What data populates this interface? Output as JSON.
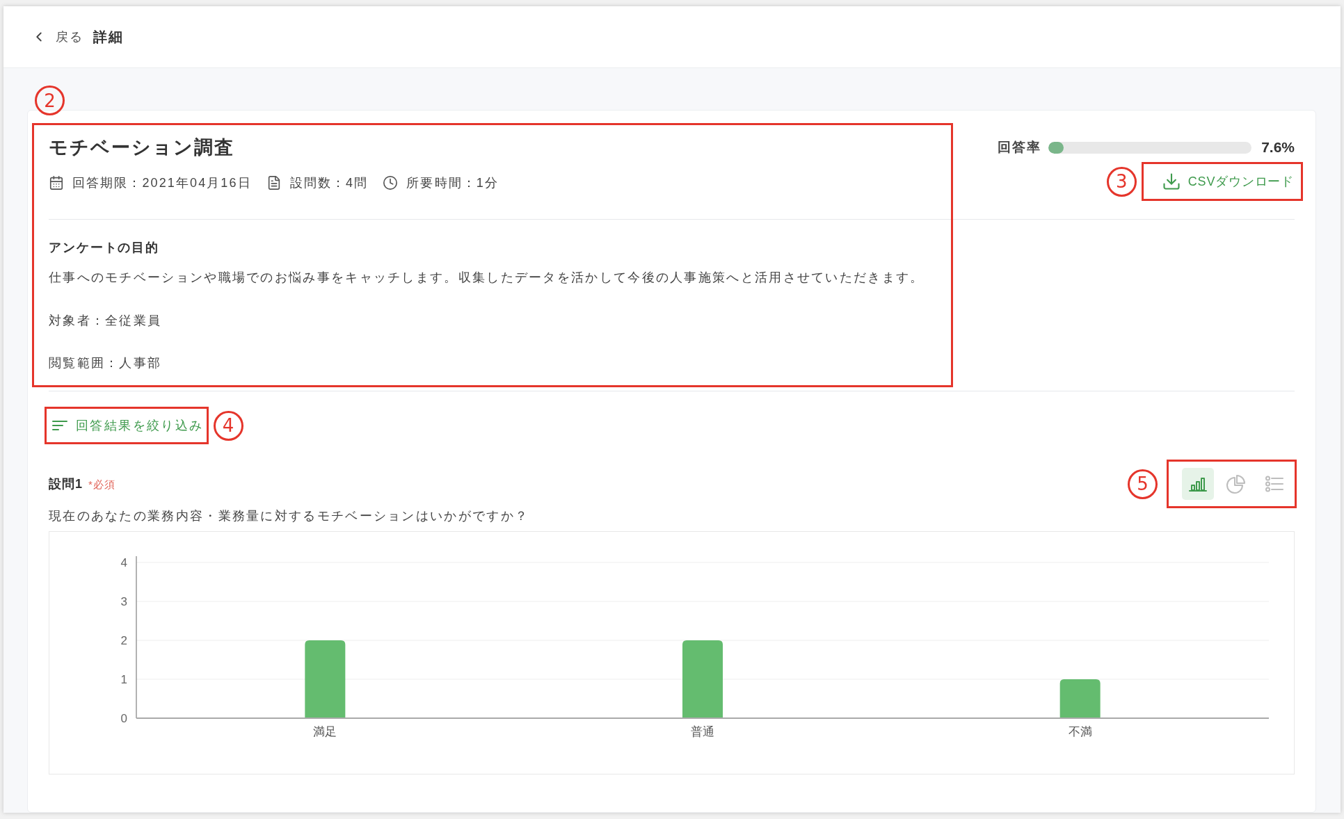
{
  "header": {
    "back": "戻る",
    "title": "詳細"
  },
  "survey": {
    "annotation": "2",
    "title": "モチベーション調査",
    "meta": [
      {
        "kind": "calendar",
        "text": "回答期限：2021年04月16日"
      },
      {
        "kind": "document",
        "text": "設問数：4問"
      },
      {
        "kind": "clock",
        "text": "所要時間：1分"
      }
    ],
    "purpose_heading": "アンケートの目的",
    "purpose": "仕事へのモチベーションや職場でのお悩み事をキャッチします。収集したデータを活かして今後の人事施策へと活用させていただきます。",
    "details": [
      "対象者：全従業員",
      "閲覧範囲：人事部"
    ]
  },
  "response_rate": {
    "label": "回答率",
    "level": 0.076,
    "reading": "7.6%"
  },
  "csv_download": {
    "annotation": "3",
    "label": "CSVダウンロード"
  },
  "filter": {
    "annotation": "4",
    "label": "回答結果を絞り込み"
  },
  "questions": [
    {
      "label": "設問1",
      "required": "*必須",
      "text": "現在のあなたの業務内容・業務量に対するモチベーションはいかがですか？",
      "views_annotation": "5",
      "views": [
        {
          "kind": "bar",
          "selected": true
        },
        {
          "kind": "pie",
          "selected": false
        },
        {
          "kind": "list",
          "selected": false
        }
      ],
      "chart_data": {
        "type": "bar",
        "categories": [
          "満足",
          "普通",
          "不満"
        ],
        "values": [
          2,
          2,
          1
        ],
        "ylim": [
          0,
          4
        ],
        "yticks": [
          0,
          1,
          2,
          3,
          4
        ],
        "grid": true
      }
    }
  ]
}
